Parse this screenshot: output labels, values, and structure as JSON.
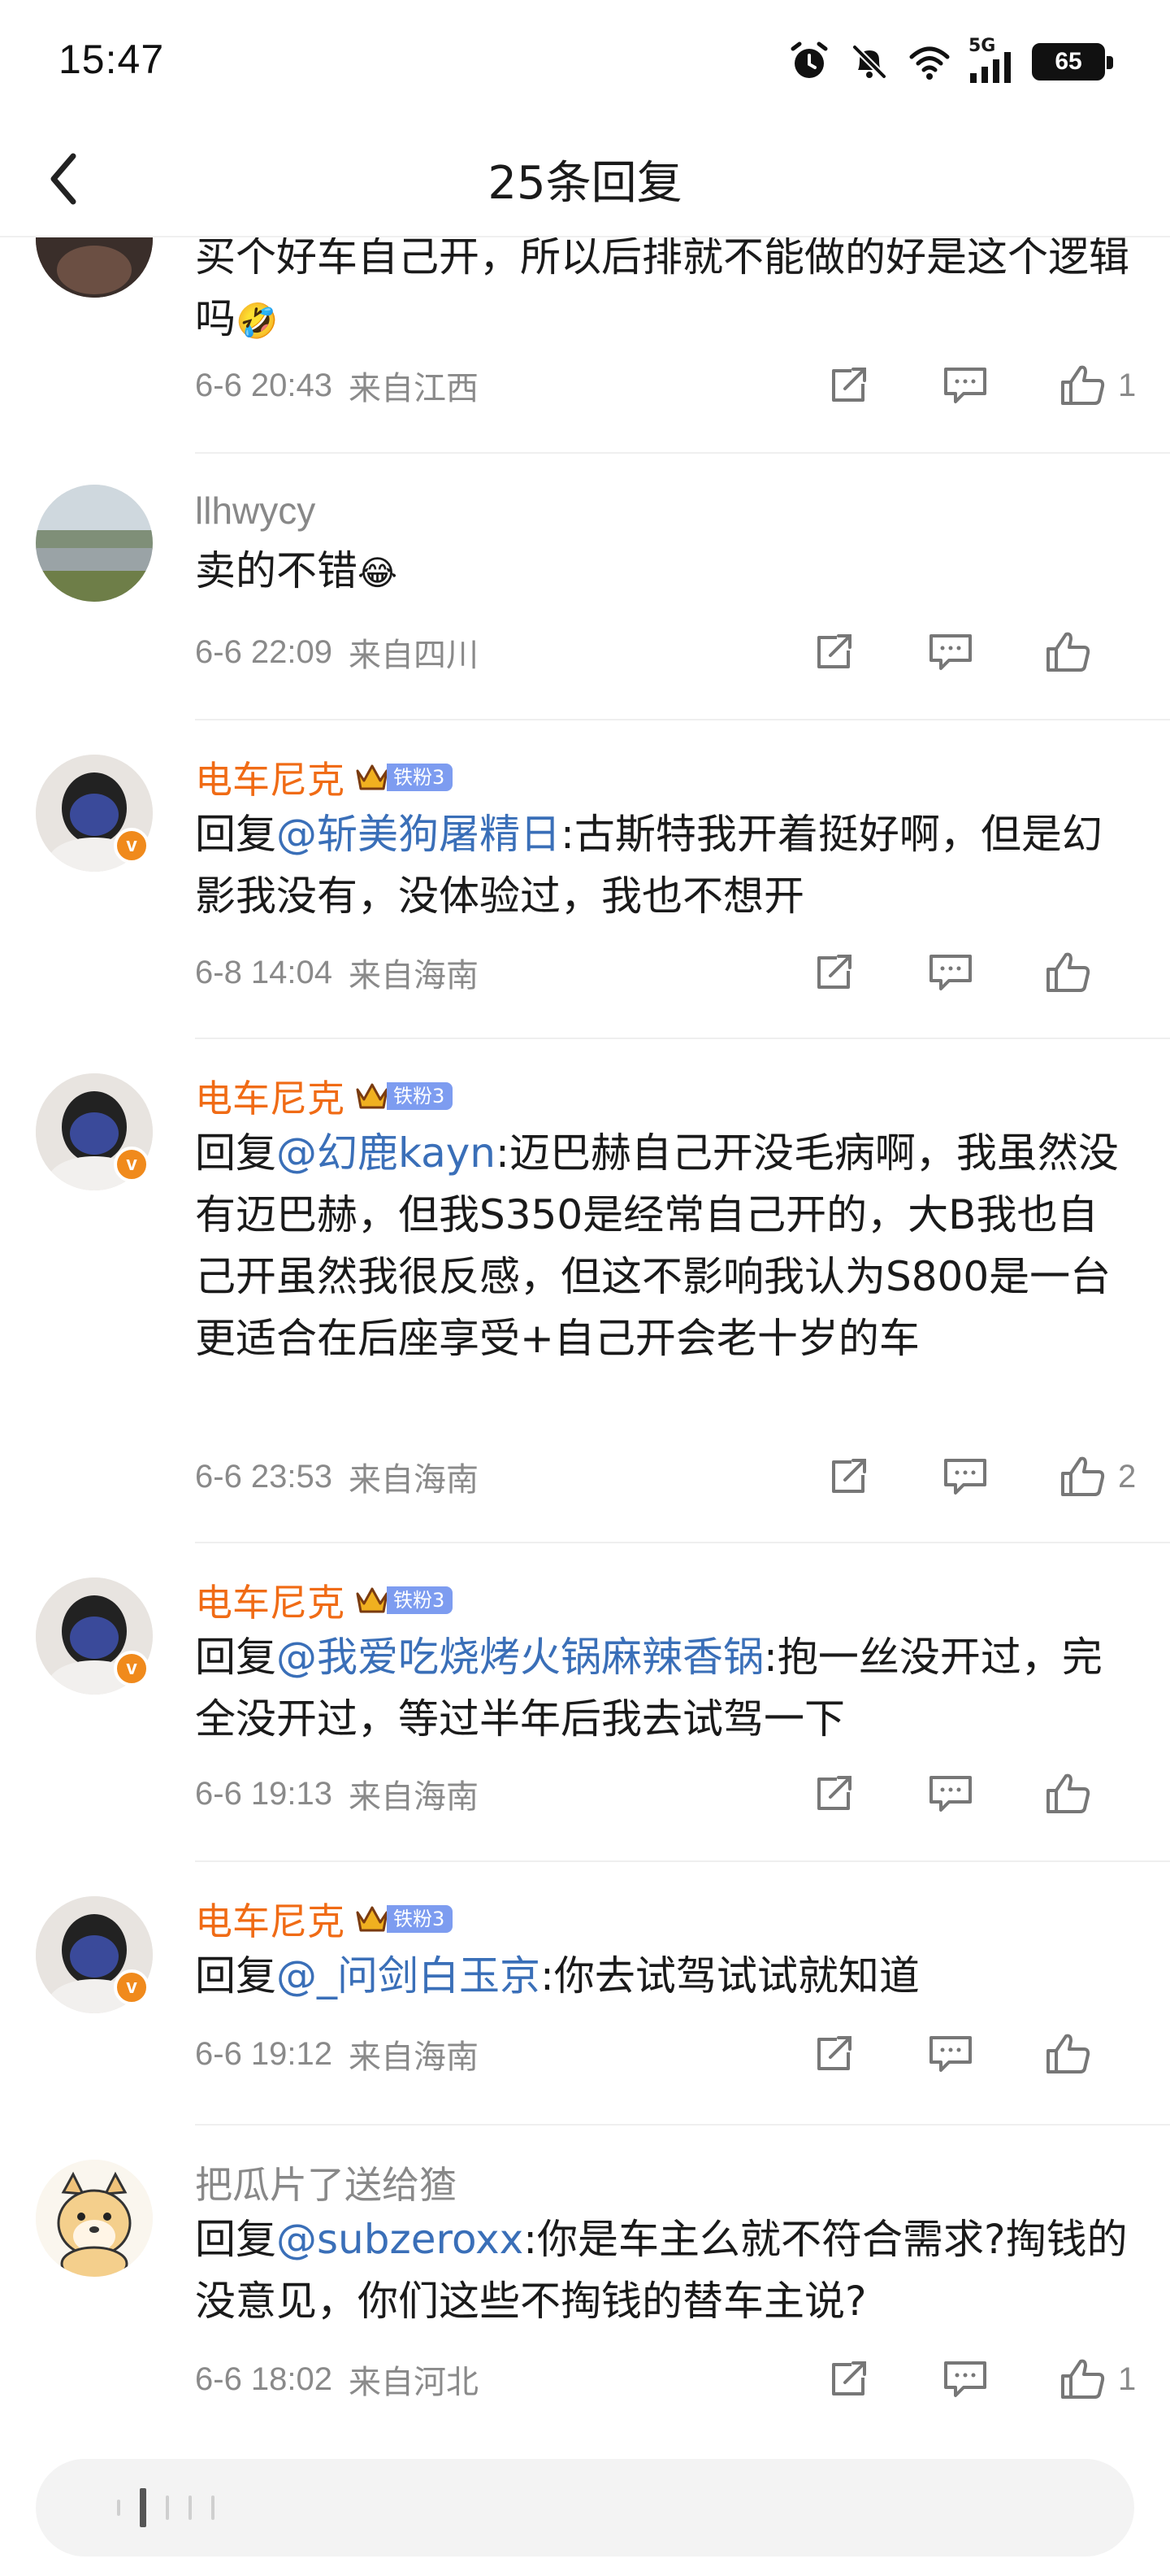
{
  "status_bar": {
    "time": "15:47",
    "network": "5G",
    "battery": "65",
    "icons": [
      "alarm-icon",
      "mute-icon",
      "wifi-icon",
      "signal-icon",
      "battery-icon"
    ]
  },
  "header": {
    "title": "25条回复",
    "back_icon": "back-arrow-icon"
  },
  "comments": [
    {
      "user": "",
      "text": "买个好车自己开，所以后排就不能做的好是这个逻辑吗",
      "emoji": "🤣",
      "time": "6-6 20:43",
      "location": "来自江西",
      "likes": "1"
    },
    {
      "user": "llhwycy",
      "text": "卖的不错",
      "emoji": "😂",
      "time": "6-6 22:09",
      "location": "来自四川",
      "likes": ""
    },
    {
      "user": "电车尼克",
      "fan_tag": "铁粉3",
      "reply_prefix": "回复",
      "mention": "@斩美狗屠精日",
      "text": ":古斯特我开着挺好啊，但是幻影我没有，没体验过，我也不想开",
      "time": "6-8 14:04",
      "location": "来自海南",
      "likes": ""
    },
    {
      "user": "电车尼克",
      "fan_tag": "铁粉3",
      "reply_prefix": "回复",
      "mention": "@幻鹿kayn",
      "text": ":迈巴赫自己开没毛病啊，我虽然没有迈巴赫，但我S350是经常自己开的，大B我也自己开虽然我很反感，但这不影响我认为S800是一台更适合在后座享受+自己开会老十岁的车",
      "time": "6-6 23:53",
      "location": "来自海南",
      "likes": "2"
    },
    {
      "user": "电车尼克",
      "fan_tag": "铁粉3",
      "reply_prefix": "回复",
      "mention": "@我爱吃烧烤火锅麻辣香锅",
      "text": ":抱一丝没开过，完全没开过，等过半年后我去试驾一下",
      "time": "6-6 19:13",
      "location": "来自海南",
      "likes": ""
    },
    {
      "user": "电车尼克",
      "fan_tag": "铁粉3",
      "reply_prefix": "回复",
      "mention": "@_问剑白玉京",
      "text": ":你去试驾试试就知道",
      "time": "6-6 19:12",
      "location": "来自海南",
      "likes": ""
    },
    {
      "user": "把瓜片了送给猹",
      "reply_prefix": "回复",
      "mention": "@subzeroxx",
      "text": ":你是车主么就不符合需求?掏钱的没意见，你们这些不掏钱的替车主说?",
      "time": "6-6 18:02",
      "location": "来自河北",
      "likes": "1"
    }
  ]
}
